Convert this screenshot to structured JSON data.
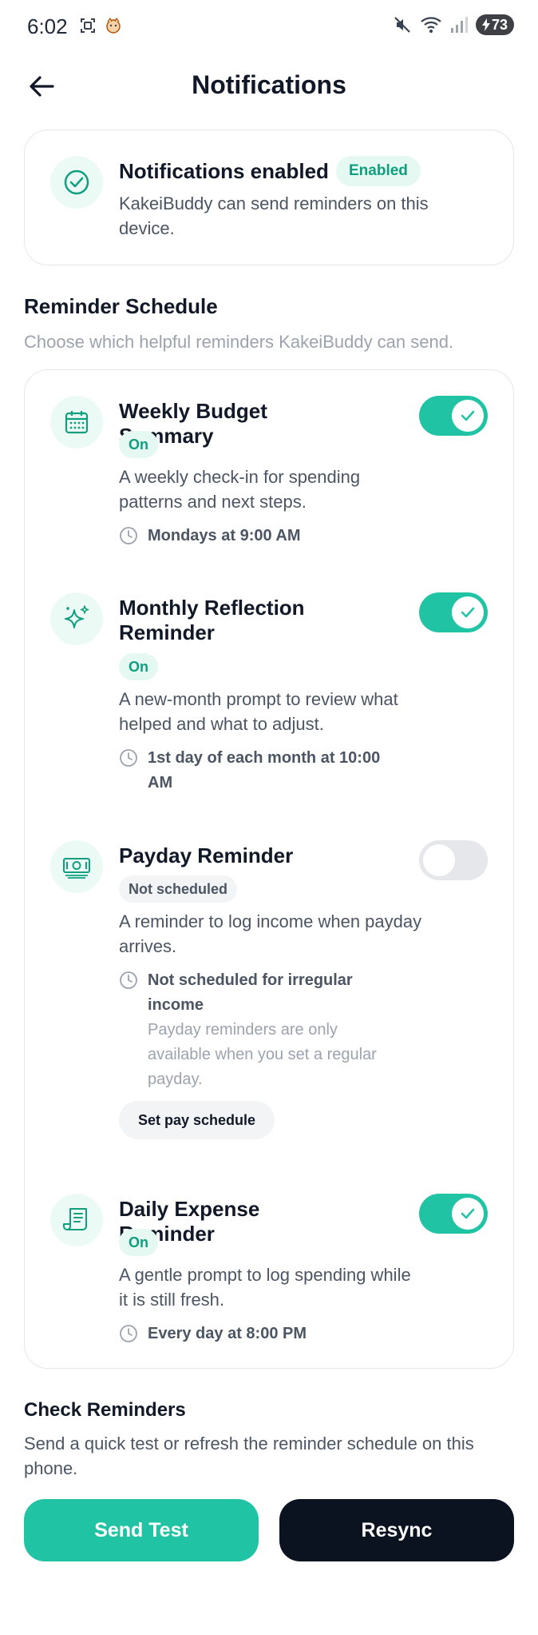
{
  "status_bar": {
    "time": "6:02",
    "battery": "73"
  },
  "header": {
    "title": "Notifications"
  },
  "notification_status": {
    "title": "Notifications enabled",
    "badge": "Enabled",
    "description": "KakeiBuddy can send reminders on this device."
  },
  "reminder_schedule": {
    "title": "Reminder Schedule",
    "subtitle": "Choose which helpful reminders KakeiBuddy can send.",
    "items": [
      {
        "icon": "calendar-icon",
        "title": "Weekly Budget Summary",
        "state": "On",
        "enabled": true,
        "description": "A weekly check-in for spending patterns and next steps.",
        "time": "Mondays at 9:00 AM"
      },
      {
        "icon": "sparkle-icon",
        "title": "Monthly Reflection Reminder",
        "state": "On",
        "enabled": true,
        "description": "A new-month prompt to review what helped and what to adjust.",
        "time": "1st day of each month at 10:00 AM"
      },
      {
        "icon": "cash-icon",
        "title": "Payday Reminder",
        "state": "Not scheduled",
        "enabled": false,
        "description": "A reminder to log income when payday arrives.",
        "time": "Not scheduled for irregular income",
        "note": "Payday reminders are only available when you set a regular payday.",
        "action_label": "Set pay schedule"
      },
      {
        "icon": "receipt-icon",
        "title": "Daily Expense Reminder",
        "state": "On",
        "enabled": true,
        "description": "A gentle prompt to log spending while it is still fresh.",
        "time": "Every day at 8:00 PM"
      }
    ]
  },
  "check_reminders": {
    "title": "Check Reminders",
    "subtitle": "Send a quick test or refresh the reminder schedule on this phone.",
    "send_test_label": "Send Test",
    "resync_label": "Resync"
  },
  "colors": {
    "accent": "#20c4a4",
    "accent_soft": "#e6f8f2",
    "dark": "#0b1220"
  }
}
